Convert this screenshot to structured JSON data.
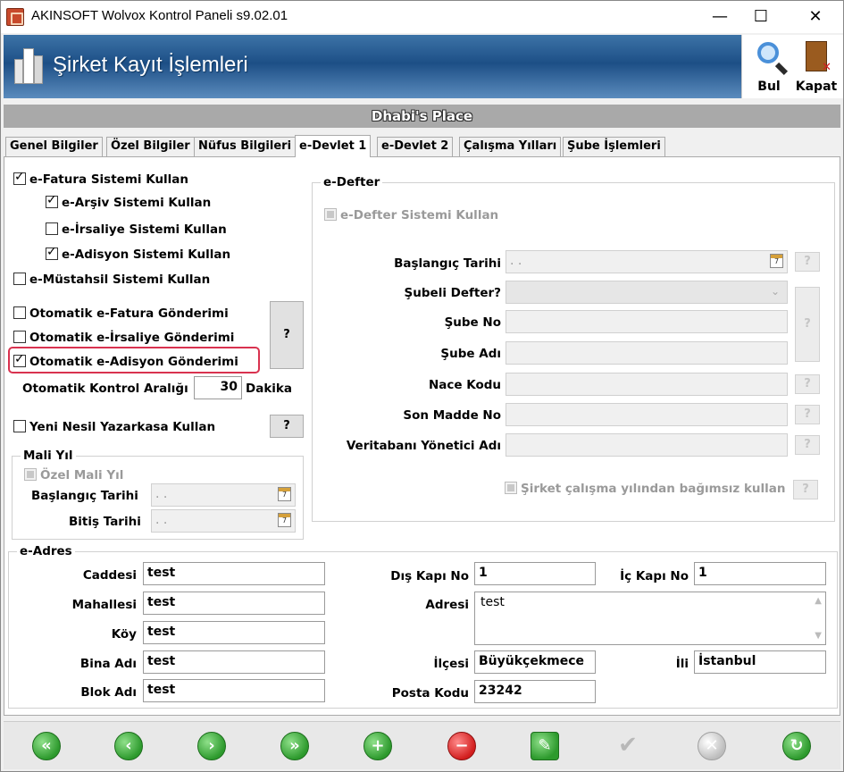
{
  "window": {
    "title": "AKINSOFT Wolvox Kontrol Paneli s9.02.01",
    "min": "—",
    "max": "☐",
    "close": "✕"
  },
  "header": {
    "title": "Şirket Kayıt İşlemleri",
    "find_label": "Bul",
    "close_label": "Kapat"
  },
  "company_name": "Dhabi's Place",
  "tabs": [
    {
      "label": "Genel Bilgiler"
    },
    {
      "label": "Özel Bilgiler"
    },
    {
      "label": "Nüfus Bilgileri"
    },
    {
      "label": "e-Devlet 1"
    },
    {
      "label": "e-Devlet 2"
    },
    {
      "label": "Çalışma Yılları"
    },
    {
      "label": "Şube İşlemleri"
    }
  ],
  "left": {
    "efatura": "e-Fatura Sistemi Kullan",
    "earsiv": "e-Arşiv Sistemi Kullan",
    "eirsaliye": "e-İrsaliye Sistemi Kullan",
    "eadisyon": "e-Adisyon Sistemi Kullan",
    "emustahsil": "e-Müstahsil Sistemi Kullan",
    "oto_efatura": "Otomatik e-Fatura Gönderimi",
    "oto_eirsaliye": "Otomatik e-İrsaliye Gönderimi",
    "oto_eadisyon": "Otomatik e-Adisyon Gönderimi",
    "help": "?",
    "interval_label": "Otomatik Kontrol Aralığı",
    "interval_value": "30",
    "interval_unit": "Dakika",
    "yazarkasa": "Yeni Nesil Yazarkasa Kullan"
  },
  "mali_yil": {
    "title": "Mali Yıl",
    "ozel": "Özel Mali Yıl",
    "start_label": "Başlangıç Tarihi",
    "end_label": "Bitiş Tarihi",
    "start_value": ". .",
    "end_value": ". .",
    "cal_day": "7"
  },
  "edefter": {
    "title": "e-Defter",
    "use": "e-Defter Sistemi Kullan",
    "start_label": "Başlangıç Tarihi",
    "start_value": ". .",
    "subeli_label": "Şubeli Defter?",
    "sube_no_label": "Şube No",
    "sube_adi_label": "Şube Adı",
    "nace_label": "Nace Kodu",
    "son_madde_label": "Son Madde No",
    "vt_label": "Veritabanı Yönetici Adı",
    "independent": "Şirket çalışma yılından bağımsız kullan",
    "help": "?"
  },
  "eadres": {
    "title": "e-Adres",
    "cadde_label": "Caddesi",
    "cadde": "test",
    "mahalle_label": "Mahallesi",
    "mahalle": "test",
    "koy_label": "Köy",
    "koy": "test",
    "bina_label": "Bina Adı",
    "bina": "test",
    "blok_label": "Blok Adı",
    "blok": "test",
    "dis_kapi_label": "Dış Kapı No",
    "dis_kapi": "1",
    "ic_kapi_label": "İç Kapı No",
    "ic_kapi": "1",
    "adres_label": "Adresi",
    "adres": "test",
    "ilce_label": "İlçesi",
    "ilce": "Büyükçekmece",
    "il_label": "İli",
    "il": "İstanbul",
    "posta_label": "Posta Kodu",
    "posta": "23242"
  },
  "nav_icons": [
    "first-record-icon",
    "previous-record-icon",
    "next-record-icon",
    "last-record-icon",
    "add-icon",
    "delete-icon",
    "edit-icon",
    "save-icon",
    "cancel-icon",
    "refresh-icon"
  ]
}
